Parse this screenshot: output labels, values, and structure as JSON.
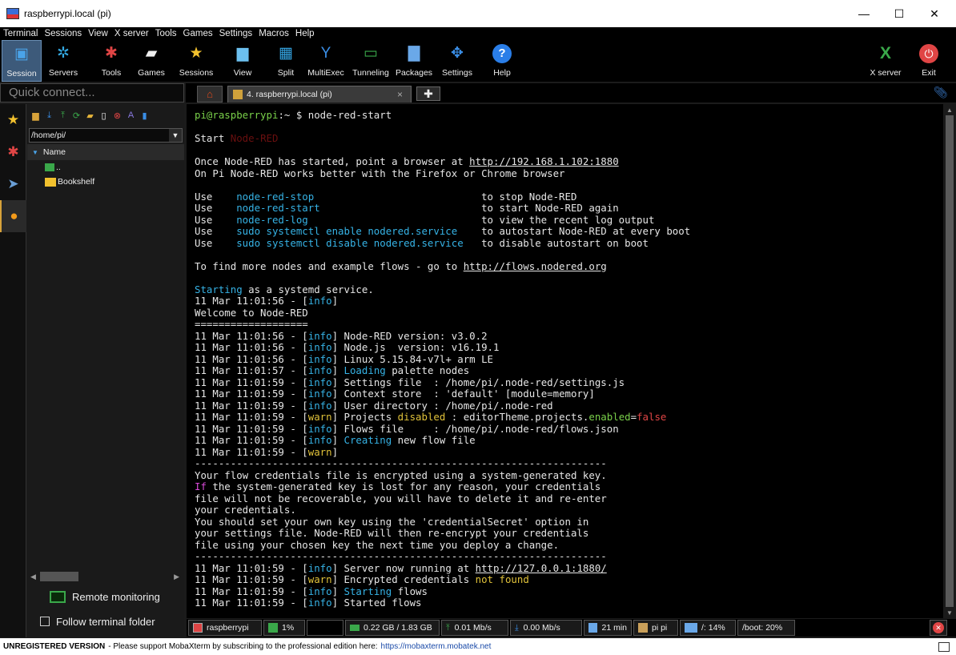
{
  "window": {
    "title": "raspberrypi.local (pi)",
    "min": "—",
    "max": "☐",
    "close": "✕"
  },
  "menu": [
    "Terminal",
    "Sessions",
    "View",
    "X server",
    "Tools",
    "Games",
    "Settings",
    "Macros",
    "Help"
  ],
  "toolbar": [
    {
      "label": "Session",
      "icon": "session-icon",
      "color": "#4aa3e8"
    },
    {
      "label": "Servers",
      "icon": "servers-icon",
      "color": "#33a8e0"
    },
    {
      "label": "Tools",
      "icon": "tools-icon",
      "color": "#e04545"
    },
    {
      "label": "Games",
      "icon": "games-icon",
      "color": "#eeeeee"
    },
    {
      "label": "Sessions",
      "icon": "star-icon",
      "color": "#f2c12e"
    },
    {
      "label": "View",
      "icon": "view-icon",
      "color": "#6cc0f0"
    },
    {
      "label": "Split",
      "icon": "split-icon",
      "color": "#35a7e6"
    },
    {
      "label": "MultiExec",
      "icon": "multiexec-icon",
      "color": "#3a8ee6"
    },
    {
      "label": "Tunneling",
      "icon": "tunneling-icon",
      "color": "#3aa84a"
    },
    {
      "label": "Packages",
      "icon": "packages-icon",
      "color": "#6aa8e8"
    },
    {
      "label": "Settings",
      "icon": "settings-icon",
      "color": "#3a8ee6"
    },
    {
      "label": "Help",
      "icon": "help-icon",
      "color": "#2a7ee8"
    }
  ],
  "toolbar_right": [
    {
      "label": "X server",
      "icon": "xserver-icon"
    },
    {
      "label": "Exit",
      "icon": "exit-icon"
    }
  ],
  "quick_connect": {
    "placeholder": "Quick connect..."
  },
  "tab": {
    "label": "4. raspberrypi.local (pi)",
    "close": "×"
  },
  "sidebar": {
    "path": "/home/pi/",
    "column": "Name",
    "files": [
      {
        "name": ".."
      },
      {
        "name": "Bookshelf"
      }
    ],
    "remote_monitoring": "Remote monitoring",
    "follow_folder": "Follow terminal folder"
  },
  "terminal": {
    "prompt_user": "pi@raspberrypi",
    "prompt_rest": ":~ $ node-red-start",
    "start": "Start",
    "start_hidden": "Node-RED",
    "l_once": "Once Node-RED has started, point a browser at ",
    "l_once_url": "http://192.168.1.102:1880",
    "l_pi": "On Pi Node-RED works better with the Firefox or Chrome browser",
    "uses": [
      {
        "cmd": "node-red-stop",
        "desc": "to stop Node-RED"
      },
      {
        "cmd": "node-red-start",
        "desc": "to start Node-RED again"
      },
      {
        "cmd": "node-red-log",
        "desc": "to view the recent log output"
      },
      {
        "cmd": "sudo systemctl enable nodered.service",
        "desc": "to autostart Node-RED at every boot"
      },
      {
        "cmd": "sudo systemctl disable nodered.service",
        "desc": "to disable autostart on boot"
      }
    ],
    "use_word": "Use",
    "more_nodes": "To find more nodes and example flows - go to ",
    "more_nodes_url": "http://flows.nodered.org",
    "starting_word": "Starting",
    "starting_rest": " as a systemd service.",
    "info_time": "11 Mar 11:01:56 - [",
    "info_word": "info",
    "welcome": "Welcome to Node-RED",
    "eq": "===================",
    "log": [
      {
        "t": "11 Mar 11:01:56",
        "lvl": "info",
        "msg": "Node-RED version: v3.0.2"
      },
      {
        "t": "11 Mar 11:01:56",
        "lvl": "info",
        "msg": "Node.js  version: v16.19.1"
      },
      {
        "t": "11 Mar 11:01:56",
        "lvl": "info",
        "msg": "Linux 5.15.84-v7l+ arm LE"
      },
      {
        "t": "11 Mar 11:01:57",
        "lvl": "info",
        "hl": "Loading",
        "msg": " palette nodes"
      },
      {
        "t": "11 Mar 11:01:59",
        "lvl": "info",
        "msg": "Settings file  : /home/pi/.node-red/settings.js"
      },
      {
        "t": "11 Mar 11:01:59",
        "lvl": "info",
        "msg": "Context store  : 'default' [module=memory]"
      },
      {
        "t": "11 Mar 11:01:59",
        "lvl": "info",
        "msg": "User directory : /home/pi/.node-red"
      },
      {
        "t": "11 Mar 11:01:59",
        "lvl": "warn",
        "msg": "Projects disabled : editorTheme.projects.enabled=false"
      },
      {
        "t": "11 Mar 11:01:59",
        "lvl": "info",
        "msg": "Flows file     : /home/pi/.node-red/flows.json"
      },
      {
        "t": "11 Mar 11:01:59",
        "lvl": "info",
        "hl": "Creating",
        "msg": " new flow file"
      },
      {
        "t": "11 Mar 11:01:59",
        "lvl": "warn",
        "msg": ""
      }
    ],
    "dashes": "---------------------------------------------------------------------",
    "cred_lines": [
      "Your flow credentials file is encrypted using a system-generated key.",
      "If",
      " the system-generated key is lost for any reason, your credentials",
      "file will not be recoverable, you will have to delete it and re-enter",
      "your credentials.",
      "You should set your own key using the 'credentialSecret' option in",
      "your settings file. Node-RED will then re-encrypt your credentials",
      "file using your chosen key the next time you deploy a change."
    ],
    "log2": [
      {
        "t": "11 Mar 11:01:59",
        "lvl": "info",
        "msg": "Server now running at ",
        "url": "http://127.0.0.1:1880/"
      },
      {
        "t": "11 Mar 11:01:59",
        "lvl": "warn",
        "msg": "Encrypted credentials ",
        "hl2": "not found"
      },
      {
        "t": "11 Mar 11:01:59",
        "lvl": "info",
        "hl": "Starting",
        "msg": " flows"
      },
      {
        "t": "11 Mar 11:01:59",
        "lvl": "info",
        "msg": "Started flows"
      }
    ]
  },
  "status": {
    "host": "raspberrypi",
    "cpu": "1%",
    "mem": "0.22 GB / 1.83 GB",
    "up": "0.01 Mb/s",
    "down": "0.00 Mb/s",
    "time": "21 min",
    "user": "pi  pi",
    "root": "/: 14%",
    "boot": "/boot: 20%"
  },
  "footer": {
    "unreg": "UNREGISTERED VERSION",
    "msg": "-  Please support MobaXterm by subscribing to the professional edition here:",
    "link": "https://mobaxterm.mobatek.net"
  }
}
